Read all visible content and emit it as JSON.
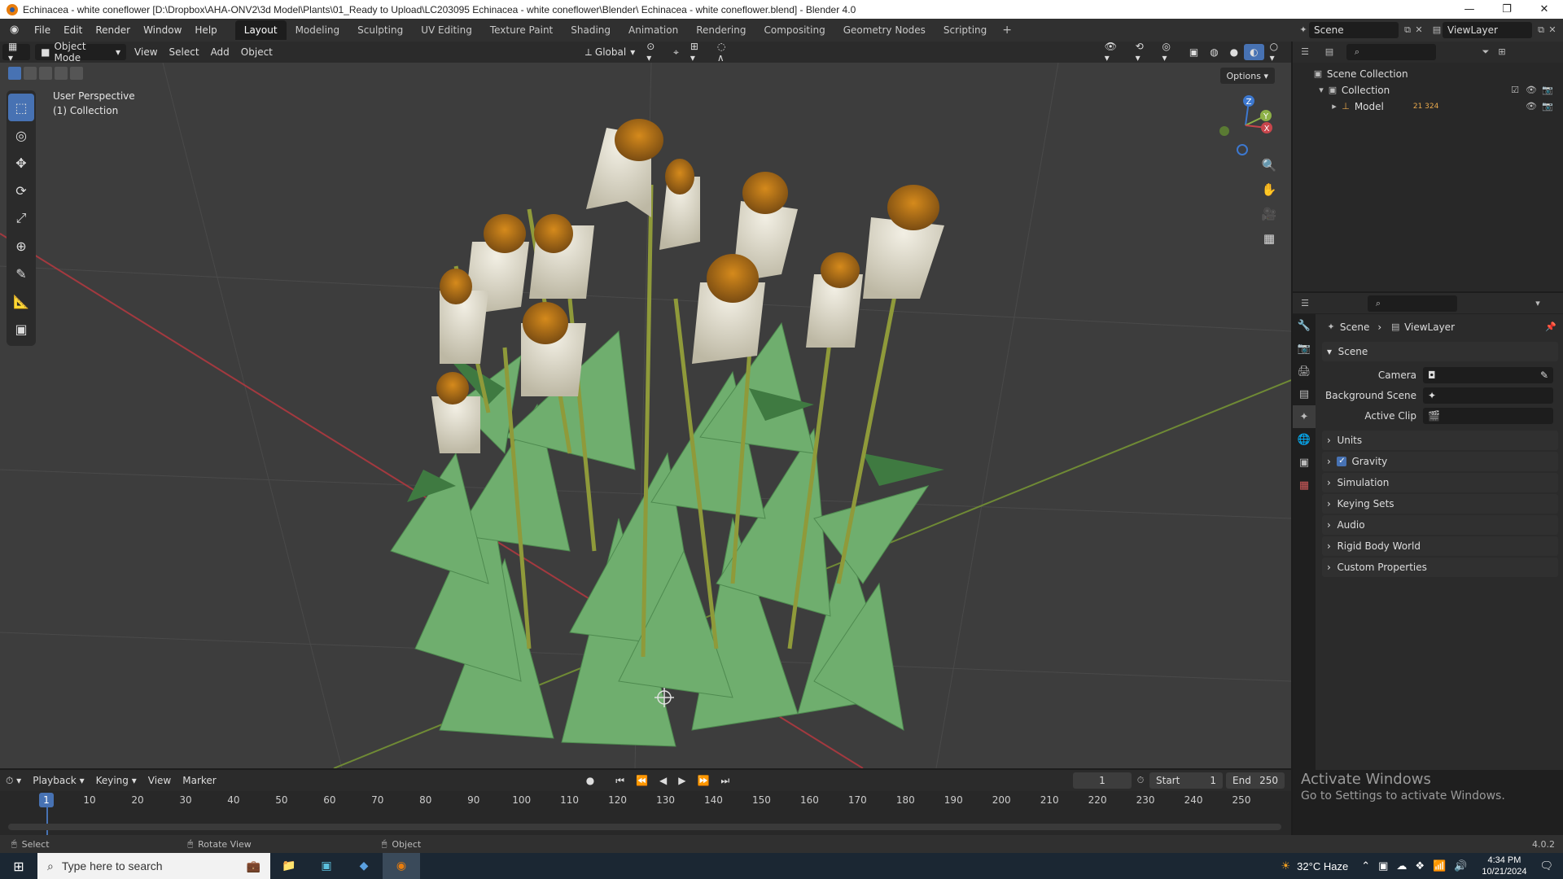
{
  "window": {
    "title": "Echinacea - white coneflower [D:\\Dropbox\\AHA-ONV2\\3d Model\\Plants\\01_Ready to Upload\\LC203095 Echinacea - white coneflower\\Blender\\ Echinacea - white coneflower.blend] - Blender 4.0",
    "minimize": "—",
    "restore": "❐",
    "close": "✕"
  },
  "menus": [
    "File",
    "Edit",
    "Render",
    "Window",
    "Help"
  ],
  "workspaces": [
    "Layout",
    "Modeling",
    "Sculpting",
    "UV Editing",
    "Texture Paint",
    "Shading",
    "Animation",
    "Rendering",
    "Compositing",
    "Geometry Nodes",
    "Scripting"
  ],
  "workspace_add": "+",
  "active_workspace": "Layout",
  "scene_field": "Scene",
  "viewlayer_field": "ViewLayer",
  "viewport_header": {
    "mode": "Object Mode",
    "menus": [
      "View",
      "Select",
      "Add",
      "Object"
    ],
    "orientation": "Global",
    "options": "Options"
  },
  "viewport": {
    "perspective": "User Perspective",
    "collection": "(1) Collection",
    "gizmo_axes": [
      "Z",
      "Y",
      "X"
    ]
  },
  "outliner": {
    "rows": [
      "Scene Collection",
      "Collection",
      "Model"
    ],
    "model_badge": "21 324"
  },
  "properties": {
    "crumb_scene": "Scene",
    "crumb_viewlayer": "ViewLayer",
    "scene_panel": "Scene",
    "fields": [
      {
        "label": "Camera"
      },
      {
        "label": "Background Scene"
      },
      {
        "label": "Active Clip"
      }
    ],
    "panels": [
      "Units",
      "Gravity",
      "Simulation",
      "Keying Sets",
      "Audio",
      "Rigid Body World",
      "Custom Properties"
    ],
    "gravity_checked": true
  },
  "timeline": {
    "menus": [
      "Playback",
      "Keying",
      "View",
      "Marker"
    ],
    "current_frame": "1",
    "start_label": "Start",
    "start": "1",
    "end_label": "End",
    "end": "250",
    "ticks": [
      "1",
      "10",
      "20",
      "30",
      "40",
      "50",
      "60",
      "70",
      "80",
      "90",
      "100",
      "110",
      "120",
      "130",
      "140",
      "150",
      "160",
      "170",
      "180",
      "190",
      "200",
      "210",
      "220",
      "230",
      "240",
      "250"
    ]
  },
  "activate": {
    "line1": "Activate Windows",
    "line2": "Go to Settings to activate Windows."
  },
  "statusbar": {
    "select": "Select",
    "rotate": "Rotate View",
    "object": "Object",
    "version": "4.0.2"
  },
  "taskbar": {
    "search_placeholder": "Type here to search",
    "weather": "32°C  Haze",
    "time": "4:34 PM",
    "date": "10/21/2024"
  },
  "colors": {
    "accent": "#4772b3",
    "x_axis": "#c8464c",
    "y_axis": "#8db047",
    "z_axis": "#3d78cf"
  }
}
